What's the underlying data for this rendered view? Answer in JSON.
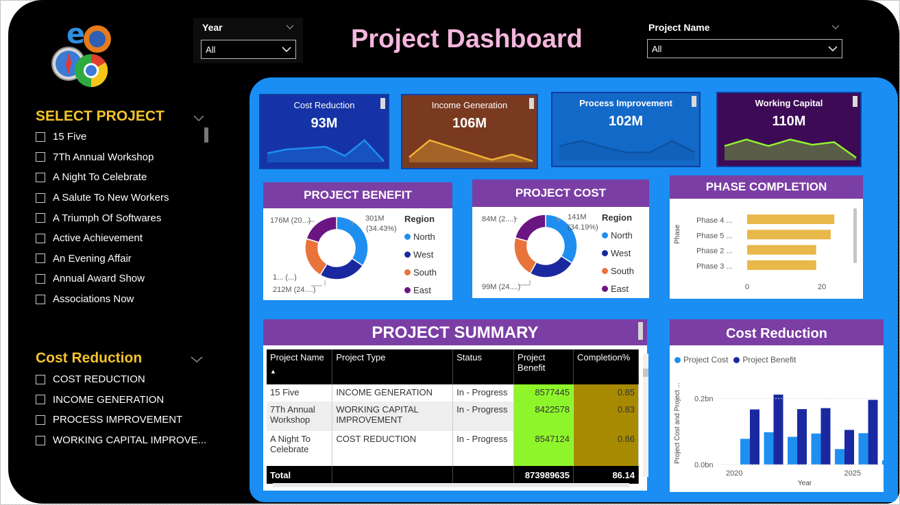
{
  "header": {
    "title": "Project Dashboard"
  },
  "filters": {
    "year": {
      "label": "Year",
      "value": "All"
    },
    "project_name": {
      "label": "Project Name",
      "value": "All"
    }
  },
  "sidebar": {
    "select_project": {
      "title": "SELECT PROJECT",
      "items": [
        "15 Five",
        "7Th Annual Workshop",
        "A Night To Celebrate",
        "A Salute To New Workers",
        "A Triumph Of Softwares",
        "Active Achievement",
        "An Evening Affair",
        "Annual Award Show",
        "Associations Now"
      ]
    },
    "cost_reduction": {
      "title": "Cost Reduction",
      "items": [
        "COST REDUCTION",
        "INCOME GENERATION",
        "PROCESS IMPROVEMENT",
        "WORKING CAPITAL IMPROVE..."
      ]
    }
  },
  "kpis": [
    {
      "title": "Cost Reduction",
      "value": "93M",
      "bg": "#1533a6",
      "line": "#1e8ff0",
      "spark": [
        0.35,
        0.5,
        0.55,
        0.6,
        0.25,
        0.85,
        0.05
      ]
    },
    {
      "title": "Income Generation",
      "value": "106M",
      "bg": "#7a3a20",
      "line": "#f2b233",
      "spark": [
        0.2,
        0.85,
        0.6,
        0.35,
        0.1,
        0.3,
        0.05
      ]
    },
    {
      "title": "Process Improvement",
      "value": "102M",
      "bg": "#1369c8",
      "line": "#0d52a3",
      "spark": [
        0.55,
        0.75,
        0.5,
        0.3,
        0.3,
        0.75,
        0.3
      ]
    },
    {
      "title": "Working Capital",
      "value": "110M",
      "bg": "#3d0a55",
      "line": "#8ff52c",
      "spark": [
        0.55,
        0.8,
        0.55,
        0.8,
        0.6,
        0.7,
        0.1
      ]
    }
  ],
  "project_benefit": {
    "title": "PROJECT BENEFIT",
    "legend_title": "Region",
    "labels": {
      "north": "301M",
      "north_pct": "(34.43%)",
      "east": "176M (20...)",
      "south_small": "1... (...)",
      "west": "212M (24....)"
    }
  },
  "project_cost": {
    "title": "PROJECT COST",
    "legend_title": "Region",
    "labels": {
      "north": "141M",
      "north_pct": "(34.19%)",
      "east": "84M (2....)",
      "west": "99M (24....)"
    }
  },
  "regions": [
    {
      "name": "North",
      "color": "#1e8ff0"
    },
    {
      "name": "West",
      "color": "#1a29a0"
    },
    {
      "name": "South",
      "color": "#e8743b"
    },
    {
      "name": "East",
      "color": "#6b1582"
    }
  ],
  "phase_completion": {
    "title": "PHASE COMPLETION",
    "axis_label": "Phase",
    "ticks": [
      "0",
      "20"
    ],
    "phases": [
      {
        "name": "Phase 4 ...",
        "value": 24
      },
      {
        "name": "Phase 5 ...",
        "value": 23
      },
      {
        "name": "Phase 2 ...",
        "value": 19
      },
      {
        "name": "Phase 3 ...",
        "value": 19
      }
    ]
  },
  "project_summary": {
    "title": "PROJECT SUMMARY",
    "columns": [
      "Project Name",
      "Project Type",
      "Status",
      "Project Benefit",
      "Completion%"
    ],
    "rows": [
      {
        "name": "15 Five",
        "type": "INCOME GENERATION",
        "status": "In - Progress",
        "benefit": "8577445",
        "completion": "0.85"
      },
      {
        "name": "7Th Annual Workshop",
        "type": "WORKING CAPITAL IMPROVEMENT",
        "status": "In - Progress",
        "benefit": "8422578",
        "completion": "0.83"
      },
      {
        "name": "A Night To Celebrate",
        "type": "COST REDUCTION",
        "status": "In - Progress",
        "benefit": "8547124",
        "completion": "0.86"
      }
    ],
    "total": {
      "label": "Total",
      "benefit": "873989635",
      "completion": "86.14"
    }
  },
  "cost_reduction_chart": {
    "title": "Cost Reduction",
    "series_names": [
      "Project Cost",
      "Project Benefit"
    ],
    "ylabel": "Project Cost and Project ...",
    "xlabel": "Year",
    "yticks": [
      "0.2bn",
      "0.0bn"
    ],
    "xticks": [
      "2020",
      "2025"
    ]
  },
  "chart_data": {
    "type": "bar",
    "title": "Cost Reduction",
    "xlabel": "Year",
    "ylabel": "Project Cost and Project ...",
    "categories": [
      "2020",
      "2021",
      "2022",
      "2023",
      "2024",
      "2025",
      "2026"
    ],
    "series": [
      {
        "name": "Project Cost",
        "color": "#1e8ff0",
        "values": [
          0.078,
          0.098,
          0.084,
          0.094,
          0.047,
          0.095,
          0.013
        ]
      },
      {
        "name": "Project Benefit",
        "color": "#1a29a0",
        "values": [
          0.167,
          0.212,
          0.168,
          0.171,
          0.105,
          0.196,
          0.025
        ]
      }
    ],
    "ylim": [
      0,
      0.22
    ],
    "legend": "top-left"
  }
}
